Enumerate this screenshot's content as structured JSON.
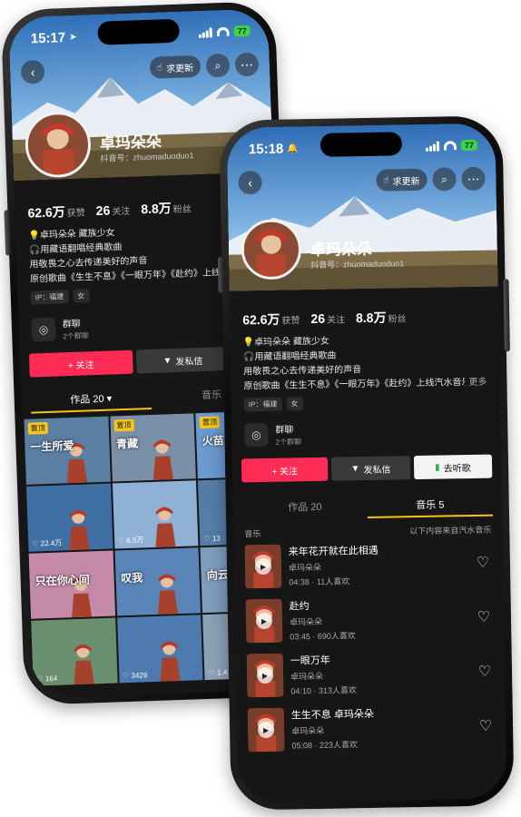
{
  "colors": {
    "follow": "#fe2c55",
    "accent": "#f5c518",
    "battery": "#3bd34a",
    "screen_bg": "#161616"
  },
  "back_phone": {
    "time": "15:17",
    "battery": "77",
    "request_update_label": "求更新",
    "profile": {
      "name": "卓玛朵朵",
      "account": "抖音号：zhuomaduoduo1"
    },
    "stats": [
      {
        "value": "62.6万",
        "label": "获赞"
      },
      {
        "value": "26",
        "label": "关注"
      },
      {
        "value": "8.8万",
        "label": "粉丝"
      }
    ],
    "bio": [
      "卓玛朵朵 藏族少女",
      "用藏语翻唱经典歌曲",
      "用敬畏之心去传递美好的声音",
      "原创歌曲《生生不息》《一眼万年》《赴约》上线汽水音乐"
    ],
    "tags": [
      "IP：福建",
      "女"
    ],
    "group": {
      "name": "群聊",
      "count": "2个群聊"
    },
    "buttons": {
      "follow": "+ 关注",
      "message": "发私信"
    },
    "tabs": [
      {
        "label": "作品 20 ▾"
      },
      {
        "label": "音乐"
      }
    ],
    "grid": [
      {
        "badge": "置顶",
        "caption": "一生所爱",
        "likes": ""
      },
      {
        "badge": "置顶",
        "caption": "青藏",
        "likes": ""
      },
      {
        "badge": "置顶",
        "caption": "火苗",
        "likes": ""
      },
      {
        "badge": "",
        "caption": "",
        "likes": "22.4万"
      },
      {
        "badge": "",
        "caption": "",
        "likes": "6.5万"
      },
      {
        "badge": "",
        "caption": "",
        "likes": "13"
      },
      {
        "badge": "",
        "caption": "只在你心间",
        "likes": ""
      },
      {
        "badge": "",
        "caption": "叹我",
        "likes": ""
      },
      {
        "badge": "",
        "caption": "向云",
        "likes": ""
      },
      {
        "badge": "",
        "caption": "",
        "likes": "164"
      },
      {
        "badge": "",
        "caption": "",
        "likes": "3429"
      },
      {
        "badge": "",
        "caption": "",
        "likes": "1.4"
      }
    ]
  },
  "front_phone": {
    "time": "15:18",
    "battery": "77",
    "request_update_label": "求更新",
    "profile": {
      "name": "卓玛朵朵",
      "account": "抖音号：zhuomaduoduo1"
    },
    "stats": [
      {
        "value": "62.6万",
        "label": "获赞"
      },
      {
        "value": "26",
        "label": "关注"
      },
      {
        "value": "8.8万",
        "label": "粉丝"
      }
    ],
    "bio": [
      "卓玛朵朵 藏族少女",
      "用藏语翻唱经典歌曲",
      "用敬畏之心去传递美好的声音",
      "原创歌曲《生生不息》《一眼万年》《赴约》上线汽水音乐啦..."
    ],
    "more_label": "更多",
    "tags": [
      "IP：福建",
      "女"
    ],
    "group": {
      "name": "群聊",
      "count": "2个群聊"
    },
    "buttons": {
      "follow": "+ 关注",
      "message": "发私信",
      "music": "去听歌"
    },
    "tabs": [
      {
        "label": "作品 20"
      },
      {
        "label": "音乐 5"
      }
    ],
    "music_section": {
      "title": "音乐",
      "source": "以下内容来自汽水音乐"
    },
    "songs": [
      {
        "title": "来年花开就在此相遇",
        "artist": "卓玛朵朵",
        "duration": "04:38",
        "likes": "11人喜欢"
      },
      {
        "title": "赴约",
        "artist": "卓玛朵朵",
        "duration": "03:45",
        "likes": "690人喜欢"
      },
      {
        "title": "一眼万年",
        "artist": "卓玛朵朵",
        "duration": "04:10",
        "likes": "313人喜欢"
      },
      {
        "title": "生生不息 卓玛朵朵",
        "artist": "卓玛朵朵",
        "duration": "05:08",
        "likes": "223人喜欢"
      }
    ]
  }
}
